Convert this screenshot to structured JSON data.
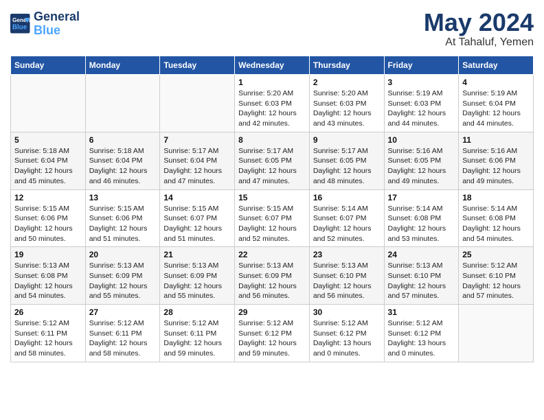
{
  "header": {
    "logo_line1": "General",
    "logo_line2": "Blue",
    "month": "May 2024",
    "location": "At Tahaluf, Yemen"
  },
  "days_of_week": [
    "Sunday",
    "Monday",
    "Tuesday",
    "Wednesday",
    "Thursday",
    "Friday",
    "Saturday"
  ],
  "weeks": [
    [
      {
        "day": "",
        "info": ""
      },
      {
        "day": "",
        "info": ""
      },
      {
        "day": "",
        "info": ""
      },
      {
        "day": "1",
        "info": "Sunrise: 5:20 AM\nSunset: 6:03 PM\nDaylight: 12 hours\nand 42 minutes."
      },
      {
        "day": "2",
        "info": "Sunrise: 5:20 AM\nSunset: 6:03 PM\nDaylight: 12 hours\nand 43 minutes."
      },
      {
        "day": "3",
        "info": "Sunrise: 5:19 AM\nSunset: 6:03 PM\nDaylight: 12 hours\nand 44 minutes."
      },
      {
        "day": "4",
        "info": "Sunrise: 5:19 AM\nSunset: 6:04 PM\nDaylight: 12 hours\nand 44 minutes."
      }
    ],
    [
      {
        "day": "5",
        "info": "Sunrise: 5:18 AM\nSunset: 6:04 PM\nDaylight: 12 hours\nand 45 minutes."
      },
      {
        "day": "6",
        "info": "Sunrise: 5:18 AM\nSunset: 6:04 PM\nDaylight: 12 hours\nand 46 minutes."
      },
      {
        "day": "7",
        "info": "Sunrise: 5:17 AM\nSunset: 6:04 PM\nDaylight: 12 hours\nand 47 minutes."
      },
      {
        "day": "8",
        "info": "Sunrise: 5:17 AM\nSunset: 6:05 PM\nDaylight: 12 hours\nand 47 minutes."
      },
      {
        "day": "9",
        "info": "Sunrise: 5:17 AM\nSunset: 6:05 PM\nDaylight: 12 hours\nand 48 minutes."
      },
      {
        "day": "10",
        "info": "Sunrise: 5:16 AM\nSunset: 6:05 PM\nDaylight: 12 hours\nand 49 minutes."
      },
      {
        "day": "11",
        "info": "Sunrise: 5:16 AM\nSunset: 6:06 PM\nDaylight: 12 hours\nand 49 minutes."
      }
    ],
    [
      {
        "day": "12",
        "info": "Sunrise: 5:15 AM\nSunset: 6:06 PM\nDaylight: 12 hours\nand 50 minutes."
      },
      {
        "day": "13",
        "info": "Sunrise: 5:15 AM\nSunset: 6:06 PM\nDaylight: 12 hours\nand 51 minutes."
      },
      {
        "day": "14",
        "info": "Sunrise: 5:15 AM\nSunset: 6:07 PM\nDaylight: 12 hours\nand 51 minutes."
      },
      {
        "day": "15",
        "info": "Sunrise: 5:15 AM\nSunset: 6:07 PM\nDaylight: 12 hours\nand 52 minutes."
      },
      {
        "day": "16",
        "info": "Sunrise: 5:14 AM\nSunset: 6:07 PM\nDaylight: 12 hours\nand 52 minutes."
      },
      {
        "day": "17",
        "info": "Sunrise: 5:14 AM\nSunset: 6:08 PM\nDaylight: 12 hours\nand 53 minutes."
      },
      {
        "day": "18",
        "info": "Sunrise: 5:14 AM\nSunset: 6:08 PM\nDaylight: 12 hours\nand 54 minutes."
      }
    ],
    [
      {
        "day": "19",
        "info": "Sunrise: 5:13 AM\nSunset: 6:08 PM\nDaylight: 12 hours\nand 54 minutes."
      },
      {
        "day": "20",
        "info": "Sunrise: 5:13 AM\nSunset: 6:09 PM\nDaylight: 12 hours\nand 55 minutes."
      },
      {
        "day": "21",
        "info": "Sunrise: 5:13 AM\nSunset: 6:09 PM\nDaylight: 12 hours\nand 55 minutes."
      },
      {
        "day": "22",
        "info": "Sunrise: 5:13 AM\nSunset: 6:09 PM\nDaylight: 12 hours\nand 56 minutes."
      },
      {
        "day": "23",
        "info": "Sunrise: 5:13 AM\nSunset: 6:10 PM\nDaylight: 12 hours\nand 56 minutes."
      },
      {
        "day": "24",
        "info": "Sunrise: 5:13 AM\nSunset: 6:10 PM\nDaylight: 12 hours\nand 57 minutes."
      },
      {
        "day": "25",
        "info": "Sunrise: 5:12 AM\nSunset: 6:10 PM\nDaylight: 12 hours\nand 57 minutes."
      }
    ],
    [
      {
        "day": "26",
        "info": "Sunrise: 5:12 AM\nSunset: 6:11 PM\nDaylight: 12 hours\nand 58 minutes."
      },
      {
        "day": "27",
        "info": "Sunrise: 5:12 AM\nSunset: 6:11 PM\nDaylight: 12 hours\nand 58 minutes."
      },
      {
        "day": "28",
        "info": "Sunrise: 5:12 AM\nSunset: 6:11 PM\nDaylight: 12 hours\nand 59 minutes."
      },
      {
        "day": "29",
        "info": "Sunrise: 5:12 AM\nSunset: 6:12 PM\nDaylight: 12 hours\nand 59 minutes."
      },
      {
        "day": "30",
        "info": "Sunrise: 5:12 AM\nSunset: 6:12 PM\nDaylight: 13 hours\nand 0 minutes."
      },
      {
        "day": "31",
        "info": "Sunrise: 5:12 AM\nSunset: 6:12 PM\nDaylight: 13 hours\nand 0 minutes."
      },
      {
        "day": "",
        "info": ""
      }
    ]
  ]
}
